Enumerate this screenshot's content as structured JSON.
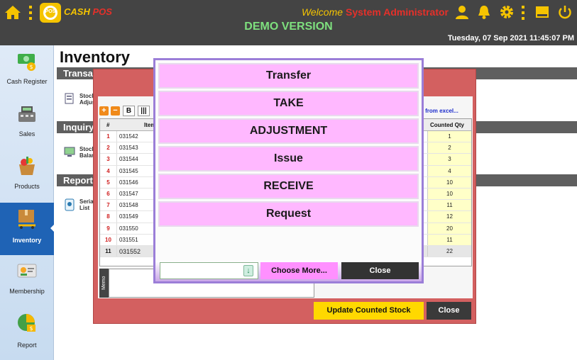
{
  "header": {
    "brand_cash": "CASH",
    "brand_pos": "POS",
    "logo_text": "POS",
    "welcome": "Welcome",
    "user_name": "System Administrator",
    "demo_label": "DEMO VERSION",
    "datetime": "Tuesday, 07 Sep 2021 11:45:07 PM",
    "icons": [
      "home-icon",
      "menu-icon",
      "user-icon",
      "bell-icon",
      "gear-icon",
      "menu-icon",
      "window-icon",
      "power-icon"
    ],
    "accent_color": "#f5c400",
    "alert_color": "#e5302a"
  },
  "sidebar": {
    "items": [
      {
        "label": "Cash Register",
        "icon": "cash-register-icon"
      },
      {
        "label": "Sales",
        "icon": "sales-icon"
      },
      {
        "label": "Products",
        "icon": "products-icon"
      },
      {
        "label": "Inventory",
        "icon": "inventory-icon",
        "active": true
      },
      {
        "label": "Membership",
        "icon": "membership-icon"
      },
      {
        "label": "Report",
        "icon": "report-icon"
      }
    ],
    "active_color": "#1f63b5"
  },
  "main": {
    "title": "Inventory",
    "sections": [
      {
        "title": "Transa",
        "items": [
          {
            "line1": "Stock",
            "line2": "Adjus"
          }
        ]
      },
      {
        "title": "Inquiry",
        "items": [
          {
            "line1": "Stock",
            "line2": "Balan"
          }
        ]
      },
      {
        "title": "Report",
        "items": [
          {
            "line1": "Serial",
            "line2": "List"
          }
        ]
      }
    ]
  },
  "stock_dialog": {
    "toolbar": {
      "add": "+",
      "remove": "−",
      "bold": "B",
      "barcode": "|||"
    },
    "import_link": "d from excel...",
    "columns": {
      "row_no": "#",
      "item": "Item",
      "counted_qty": "Counted Qty"
    },
    "rows": [
      {
        "no": "1",
        "code": "031542",
        "qty": "1"
      },
      {
        "no": "2",
        "code": "031543",
        "qty": "2"
      },
      {
        "no": "3",
        "code": "031544",
        "qty": "3"
      },
      {
        "no": "4",
        "code": "031545",
        "qty": "4"
      },
      {
        "no": "5",
        "code": "031546",
        "qty": "10"
      },
      {
        "no": "6",
        "code": "031547",
        "qty": "10"
      },
      {
        "no": "7",
        "code": "031548",
        "qty": "11"
      },
      {
        "no": "8",
        "code": "031549",
        "qty": "12"
      },
      {
        "no": "9",
        "code": "031550",
        "qty": "20"
      },
      {
        "no": "10",
        "code": "031551",
        "qty": "11"
      },
      {
        "no": "11",
        "code": "031552",
        "qty": "22"
      }
    ],
    "memo_label": "Memo",
    "memo_value": "",
    "update_button": "Update Counted Stock",
    "close_button": "Close"
  },
  "type_picker": {
    "options": [
      "Transfer",
      "TAKE",
      "ADJUSTMENT",
      "Issue",
      "RECEIVE",
      "Request"
    ],
    "search_value": "",
    "choose_more": "Choose More...",
    "close": "Close",
    "option_color": "#ffb8ff",
    "border_color": "#9b7ed8"
  }
}
